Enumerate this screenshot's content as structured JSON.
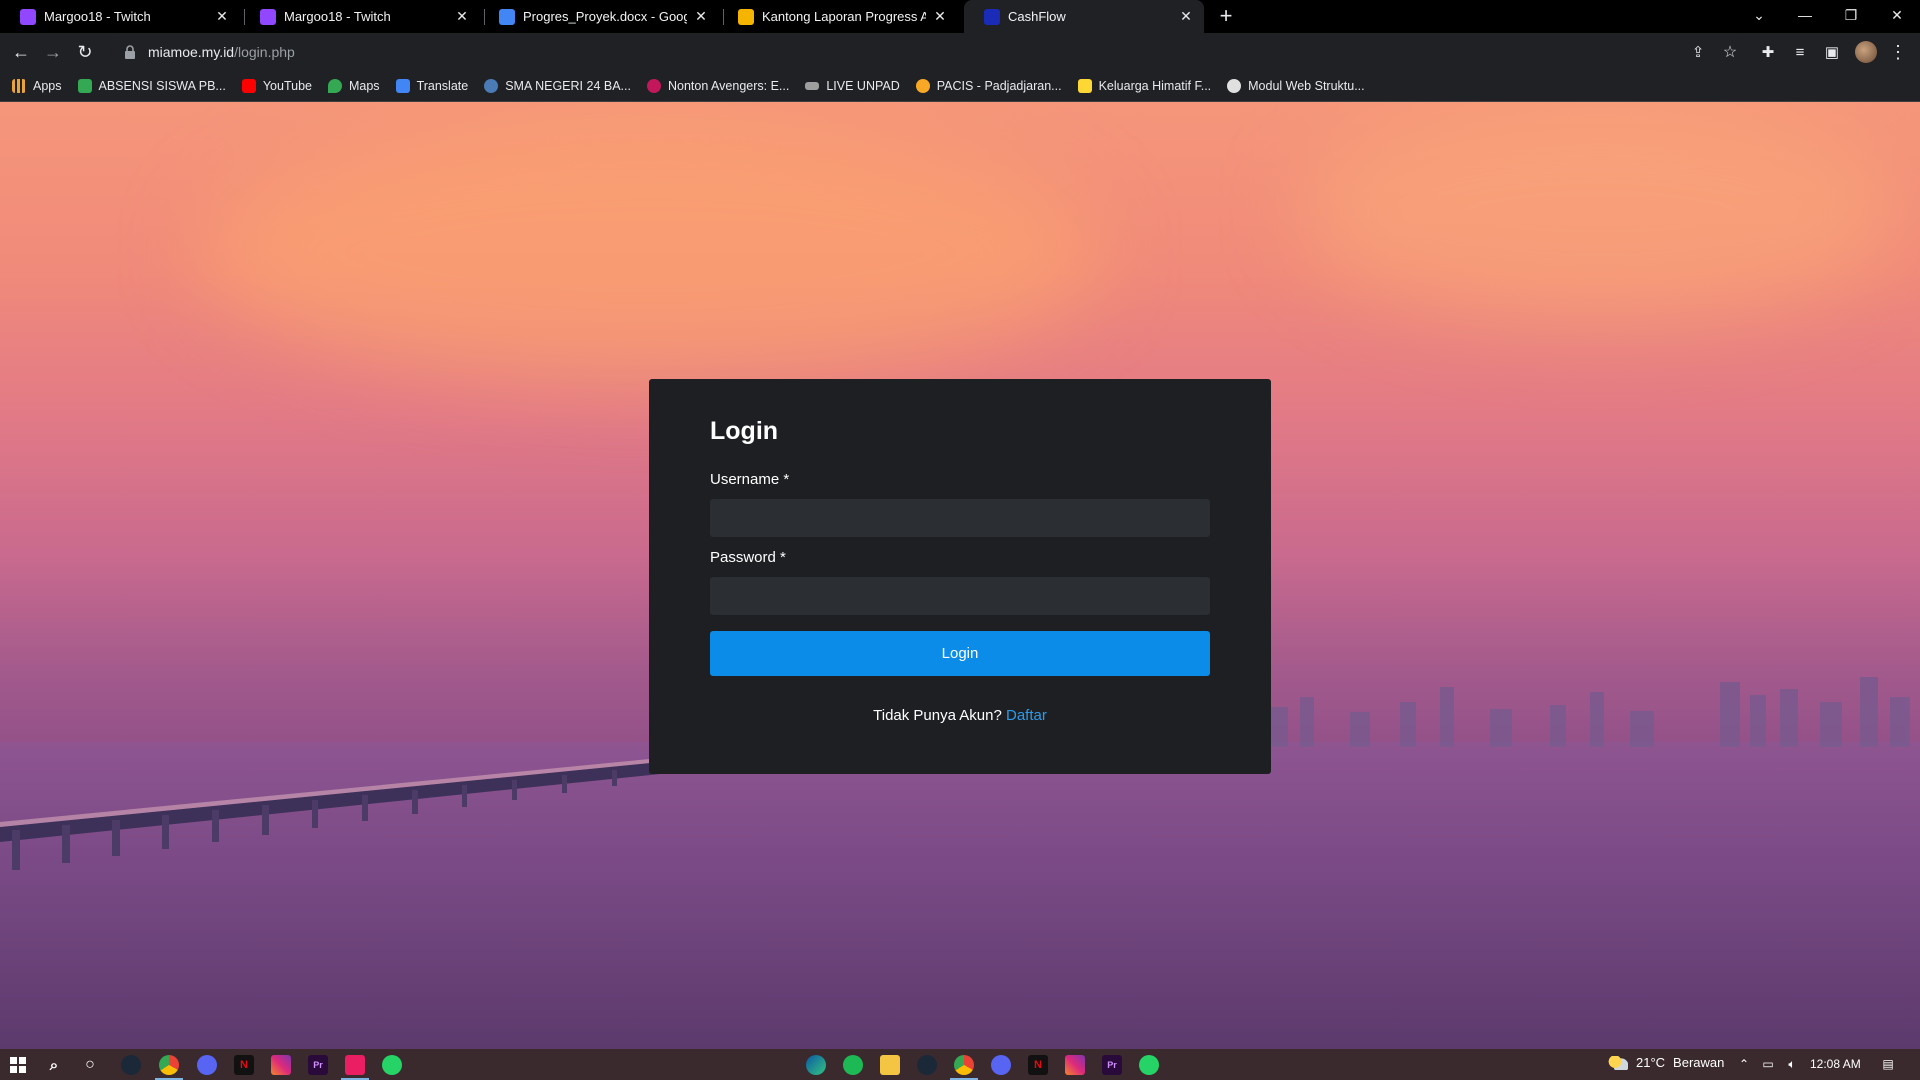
{
  "browser": {
    "tabs": [
      {
        "title": "Margoo18 - Twitch",
        "favicon": "twitch-icon",
        "color": "#9146ff",
        "active": false
      },
      {
        "title": "Margoo18 - Twitch",
        "favicon": "twitch-icon",
        "color": "#9146ff",
        "active": false
      },
      {
        "title": "Progres_Proyek.docx - Google Do",
        "favicon": "google-docs-icon",
        "color": "#4285f4",
        "active": false
      },
      {
        "title": "Kantong Laporan Progress Aplika",
        "favicon": "slides-icon",
        "color": "#f4b400",
        "active": false
      },
      {
        "title": "CashFlow",
        "favicon": "cashflow-icon",
        "color": "#1a2bb8",
        "active": true
      }
    ],
    "url_host": "miamoe.my.id",
    "url_path": "/login.php",
    "bookmarks": [
      {
        "label": "Apps",
        "icon": "apps-grid-icon",
        "color": "#e8a33d"
      },
      {
        "label": "ABSENSI SISWA PB...",
        "icon": "drive-icon",
        "color": "#34a853"
      },
      {
        "label": "YouTube",
        "icon": "youtube-icon",
        "color": "#ff0000"
      },
      {
        "label": "Maps",
        "icon": "maps-icon",
        "color": "#34a853"
      },
      {
        "label": "Translate",
        "icon": "translate-icon",
        "color": "#4285f4"
      },
      {
        "label": "SMA NEGERI 24 BA...",
        "icon": "school-icon",
        "color": "#4a7bb5"
      },
      {
        "label": "Nonton Avengers: E...",
        "icon": "movie-icon",
        "color": "#c2185b"
      },
      {
        "label": "LIVE UNPAD",
        "icon": "live-icon",
        "color": "#9e9e9e"
      },
      {
        "label": "PACIS - Padjadjaran...",
        "icon": "pacis-icon",
        "color": "#f9a825"
      },
      {
        "label": "Keluarga Himatif F...",
        "icon": "himatif-icon",
        "color": "#fdd835"
      },
      {
        "label": "Modul Web Struktu...",
        "icon": "modul-icon",
        "color": "#e0e0e0"
      }
    ]
  },
  "login": {
    "title": "Login",
    "username_label": "Username *",
    "username_value": "",
    "password_label": "Password *",
    "password_value": "",
    "button_label": "Login",
    "register_prompt": "Tidak Punya Akun?",
    "register_link": "Daftar"
  },
  "taskbar": {
    "weather_temp": "21°C",
    "weather_text": "Berawan",
    "time": "12:08 AM"
  }
}
